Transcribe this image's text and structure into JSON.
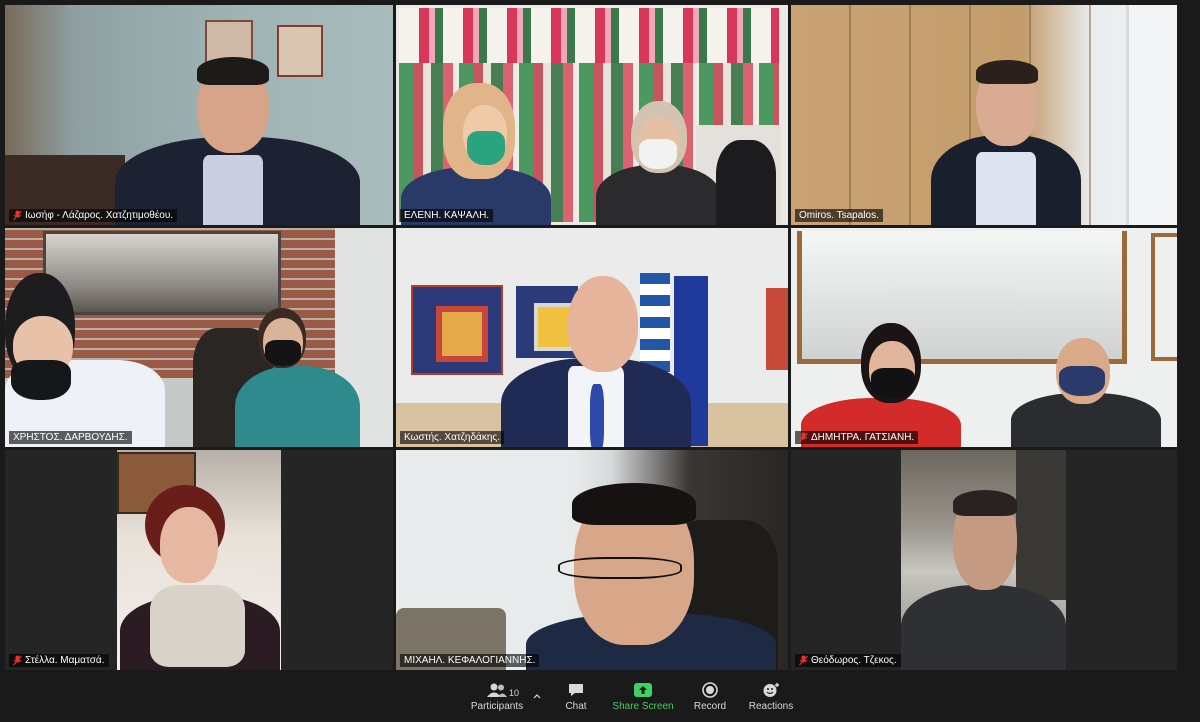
{
  "participants": [
    {
      "name": "Ιωσήφ - Λάζαρος. Χατζητιμοθέου.",
      "muted": true
    },
    {
      "name": "ΕΛΕΝΗ. ΚΑΨΑΛΗ.",
      "muted": false,
      "active_speaker": true
    },
    {
      "name": "Omiros. Tsapalos.",
      "muted": false
    },
    {
      "name": "ΧΡΗΣΤΟΣ. ΔΑΡΒΟΥΔΗΣ.",
      "muted": false
    },
    {
      "name": "Κωστής. Χατζηδάκης.",
      "muted": false
    },
    {
      "name": "ΔΗΜΗΤΡΑ. ΓΑΤΣΙΑΝΗ.",
      "muted": true
    },
    {
      "name": "Στέλλα. Μαματσά.",
      "muted": true
    },
    {
      "name": "ΜΙΧΑΗΛ. ΚΕΦΑΛΟΓΙΑΝΝΗΣ.",
      "muted": false
    },
    {
      "name": "Θεόδωρος. Τζεκος.",
      "muted": true
    }
  ],
  "toolbar": {
    "participants_label": "Participants",
    "participants_count": "10",
    "chat_label": "Chat",
    "share_label": "Share Screen",
    "record_label": "Record",
    "reactions_label": "Reactions"
  },
  "colors": {
    "active_border": "#c8e04a",
    "share_green": "#3fd163",
    "mute_red": "#e0352b"
  }
}
